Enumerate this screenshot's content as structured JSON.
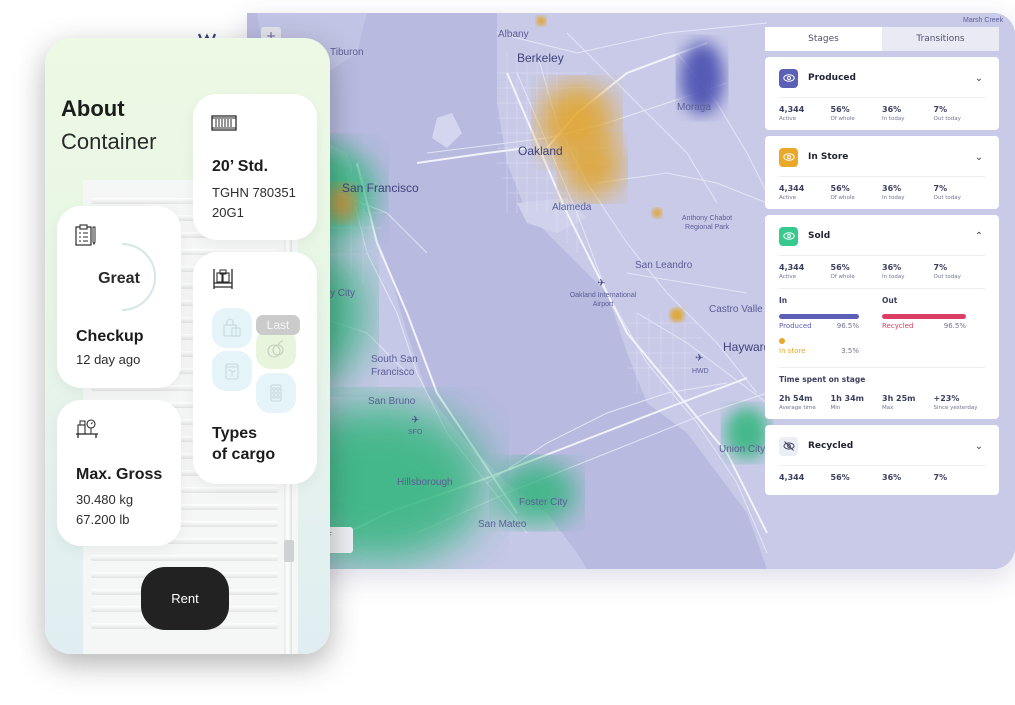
{
  "map": {
    "zoom_in_label": "+",
    "scale_label": "OF",
    "labels": {
      "tiburon": "Tiburon",
      "albany": "Albany",
      "berkeley": "Berkeley",
      "oakland": "Oakland",
      "alameda": "Alameda",
      "moraga": "Moraga",
      "anthony_chabot": "Anthony Chabot Regional Park",
      "san_francisco": "San Francisco",
      "daly_city": "y City",
      "san_leandro": "San Leandro",
      "oakland_airport": "Oakland International Airport",
      "castro_valley": "Castro Valle",
      "hayward": "Hayward",
      "hwd": "HWD",
      "south_sf_1": "South San",
      "south_sf_2": "Francisco",
      "san_bruno": "San Bruno",
      "sfo": "SFO",
      "hillsborough": "Hillsborough",
      "foster_city": "Foster City",
      "san_mateo": "San Mateo",
      "union_city": "Union City",
      "marsh_creek": "Marsh Creek"
    },
    "heat_colors": {
      "purple": "#4a4fb0",
      "orange": "#e3a321",
      "green": "#2fb57a"
    }
  },
  "panel": {
    "tabs": [
      {
        "label": "Stages",
        "active": true
      },
      {
        "label": "Transitions",
        "active": false
      }
    ],
    "stages": [
      {
        "name": "Produced",
        "icon": "eye-icon",
        "color": "#5b5fb5",
        "expanded": false,
        "stats": [
          {
            "value": "4,344",
            "label": "Active"
          },
          {
            "value": "56%",
            "label": "Of whole"
          },
          {
            "value": "36%",
            "label": "In today"
          },
          {
            "value": "7%",
            "label": "Out today"
          }
        ]
      },
      {
        "name": "In Store",
        "icon": "eye-icon",
        "color": "#e9a82a",
        "expanded": false,
        "stats": [
          {
            "value": "4,344",
            "label": "Active"
          },
          {
            "value": "56%",
            "label": "Of whole"
          },
          {
            "value": "36%",
            "label": "In today"
          },
          {
            "value": "7%",
            "label": "Out today"
          }
        ]
      },
      {
        "name": "Sold",
        "icon": "eye-icon",
        "color": "#37c98e",
        "expanded": true,
        "stats": [
          {
            "value": "4,344",
            "label": "Active"
          },
          {
            "value": "56%",
            "label": "Of whole"
          },
          {
            "value": "36%",
            "label": "In today"
          },
          {
            "value": "7%",
            "label": "Out today"
          }
        ],
        "in": {
          "heading": "In",
          "items": [
            {
              "label": "Produced",
              "value": "96.5%",
              "fraction": 0.965,
              "color": "#5b5fb5"
            },
            {
              "label": "In store",
              "value": "3.5%",
              "fraction": 0.035,
              "color": "#e9a82a"
            }
          ]
        },
        "out": {
          "heading": "Out",
          "items": [
            {
              "label": "Recycled",
              "value": "96.5%",
              "fraction": 0.965,
              "color": "#dc3d63"
            }
          ]
        },
        "time": {
          "heading": "Time spent on stage",
          "stats": [
            {
              "value": "2h 54m",
              "label": "Average time"
            },
            {
              "value": "1h 34m",
              "label": "Min"
            },
            {
              "value": "3h 25m",
              "label": "Max"
            },
            {
              "value": "+23%",
              "label": "Since yesterday"
            }
          ]
        }
      },
      {
        "name": "Recycled",
        "icon": "eye-off-icon",
        "color": "#eceef6",
        "expanded": false,
        "stats": [
          {
            "value": "4,344",
            "label": ""
          },
          {
            "value": "56%",
            "label": ""
          },
          {
            "value": "36%",
            "label": ""
          },
          {
            "value": "7%",
            "label": ""
          }
        ]
      }
    ]
  },
  "phone": {
    "title": "About",
    "subtitle": "Container",
    "size_card": {
      "title": "20’ Std.",
      "line1": "TGHN 780351",
      "line2": "20G1"
    },
    "checkup_card": {
      "gauge_text": "Great",
      "title": "Checkup",
      "subtitle": "12 day ago"
    },
    "gross_card": {
      "title": "Max. Gross",
      "line1": "30.480 kg",
      "line2": "67.200 lb"
    },
    "cargo_card": {
      "badge": "Last",
      "title_line1": "Types",
      "title_line2": "of cargo"
    },
    "rent_label": "Rent"
  }
}
